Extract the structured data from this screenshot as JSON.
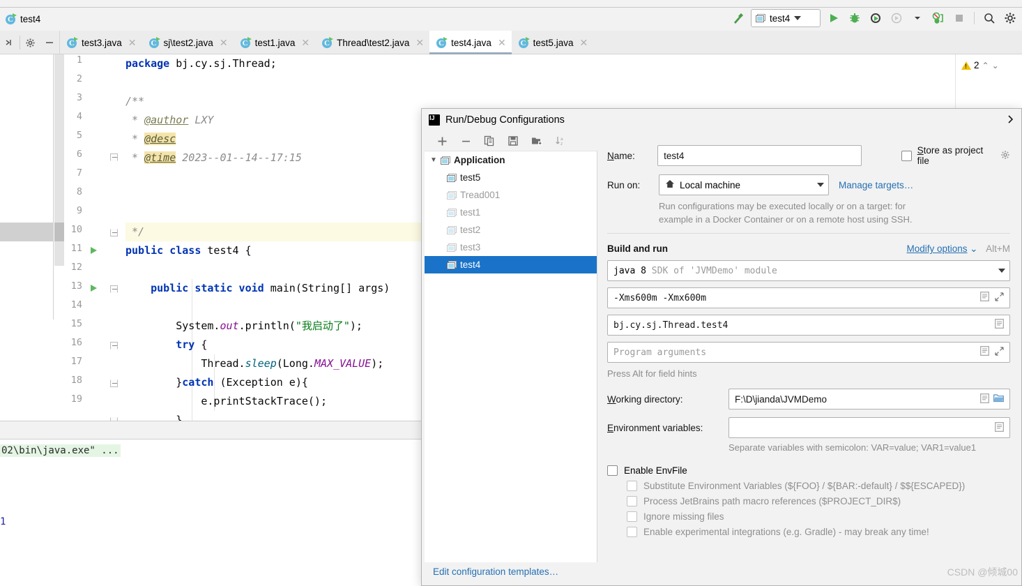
{
  "navbar": {
    "crumb": "test4",
    "icon": "java-class-icon"
  },
  "run_toolbar": {
    "build_icon": "hammer-icon",
    "config_name": "test4",
    "config_icon": "application-config-icon",
    "run_icon": "run-icon",
    "debug_icon": "debug-icon",
    "run_coverage_icon": "run-with-coverage-icon",
    "profiler_icon": "profiler-icon",
    "profiler_dropdown_icon": "chevron-down-icon",
    "attach_icon": "attach-debugger-icon",
    "stop_icon": "stop-icon",
    "search_icon": "search-icon",
    "settings_icon": "gear-icon"
  },
  "tab_toolbar": {
    "collapse_icon": "collapse-icon",
    "settings_icon": "gear-icon",
    "hide_icon": "minus-icon"
  },
  "editor_tabs": [
    {
      "label": "test3.java",
      "active": false
    },
    {
      "label": "sj\\test2.java",
      "active": false
    },
    {
      "label": "test1.java",
      "active": false
    },
    {
      "label": "Thread\\test2.java",
      "active": false
    },
    {
      "label": "test4.java",
      "active": true
    },
    {
      "label": "test5.java",
      "active": false
    }
  ],
  "editor": {
    "warning_count": "2",
    "warning_icon": "warning-triangle-icon",
    "up_icon": "chevron-up-icon",
    "down_icon": "chevron-down-icon",
    "line_numbers": [
      "1",
      "2",
      "3",
      "4",
      "5",
      "6",
      "7",
      "8",
      "9",
      "10",
      "11",
      "12",
      "13",
      "14",
      "15",
      "16",
      "17",
      "18",
      "19"
    ],
    "code": {
      "l1_package": "package",
      "l1_name": " bj.cy.sj.Thread;",
      "l3": "/**",
      "l4_star": " * ",
      "l4_tag": "@author",
      "l4_val": " LXY",
      "l5_star": " * ",
      "l5_tag": "@desc",
      "l6_star": " * ",
      "l6_tag": "@time",
      "l6_val": " 2023--01--14--17:15",
      "l7": " */",
      "l8_a": "public class",
      "l8_b": " test4 {",
      "l10_a": "    public static void",
      "l10_b": " main(String[] args)",
      "l12_a": "        System.",
      "l12_b": "out",
      "l12_c": ".println(",
      "l12_str": "\"我启动了\"",
      "l12_d": ");",
      "l13_a": "        ",
      "l13_kw": "try",
      "l13_b": " {",
      "l14_a": "            Thread.",
      "l14_b": "sleep",
      "l14_c": "(Long.",
      "l14_d": "MAX_VALUE",
      "l14_e": ");",
      "l15_a": "        }",
      "l15_kw": "catch",
      "l15_b": " (Exception e){",
      "l16": "            e.printStackTrace();",
      "l17": "        }",
      "l18": "    }",
      "l19": "}"
    }
  },
  "console": {
    "command_line": "02\\bin\\java.exe\" ...",
    "output_line": "1"
  },
  "dialog": {
    "title": "Run/Debug Configurations",
    "logo_icon": "intellij-logo-icon",
    "close_icon": "close-icon",
    "toolbar": [
      {
        "name": "add-configuration-button",
        "glyph": "+"
      },
      {
        "name": "remove-configuration-button",
        "glyph": "−"
      },
      {
        "name": "copy-configuration-button",
        "glyph": "copy-icon"
      },
      {
        "name": "save-configuration-button",
        "glyph": "save-icon"
      },
      {
        "name": "move-into-folder-button",
        "glyph": "folder-add-icon"
      },
      {
        "name": "sort-configurations-button",
        "glyph": "sort-alpha-icon"
      }
    ],
    "tree": {
      "root": "Application",
      "root_twisty": "chevron-down-icon",
      "items": [
        {
          "label": "test5",
          "dim": false,
          "selected": false
        },
        {
          "label": "Tread001",
          "dim": true,
          "selected": false
        },
        {
          "label": "test1",
          "dim": true,
          "selected": false
        },
        {
          "label": "test2",
          "dim": true,
          "selected": false
        },
        {
          "label": "test3",
          "dim": true,
          "selected": false
        },
        {
          "label": "test4",
          "dim": false,
          "selected": true
        }
      ]
    },
    "edit_templates_link": "Edit configuration templates…",
    "name_label": "Name:",
    "name_value": "test4",
    "store_as_project_file_label": "Store as project file",
    "store_as_project_file_gear_icon": "gear-icon",
    "run_on_label": "Run on:",
    "run_on_value": "Local machine",
    "run_on_icon": "home-icon",
    "manage_targets_link": "Manage targets…",
    "run_on_hint_1": "Run configurations may be executed locally or on a target: for",
    "run_on_hint_2": "example in a Docker Container or on a remote host using SSH.",
    "build_and_run_label": "Build and run",
    "modify_options_link": "Modify options",
    "modify_options_caret_icon": "chevron-down-icon",
    "modify_options_shortcut": "Alt+M",
    "jdk_value_a": "java 8",
    "jdk_value_b": " SDK of 'JVMDemo' module",
    "vm_options_value": "-Xms600m  -Xmx600m",
    "main_class_value": "bj.cy.sj.Thread.test4",
    "program_args_placeholder": "Program arguments",
    "field_hint": "Press Alt for field hints",
    "working_directory_label": "Working directory:",
    "working_directory_value": "F:\\D\\jianda\\JVMDemo",
    "environment_variables_label": "Environment variables:",
    "environment_variables_value": "",
    "env_hint": "Separate variables with semicolon: VAR=value; VAR1=value1",
    "enable_envfile_label": "Enable EnvFile",
    "envfile_options": [
      "Substitute Environment Variables (${FOO} / ${BAR:-default} / $${ESCAPED})",
      "Process JetBrains path macro references ($PROJECT_DIR$)",
      "Ignore missing files",
      "Enable experimental integrations (e.g. Gradle) - may break any time!"
    ],
    "macro_icon": "insert-macro-icon",
    "expand_icon": "expand-icon",
    "browse_icon": "folder-browse-icon"
  },
  "watermark": "CSDN @倾城00",
  "colors": {
    "accent_blue": "#1a73c8",
    "link_blue": "#2470b3",
    "keyword": "#0033b3",
    "string_green": "#067d17",
    "field_purple": "#871094",
    "comment_gray": "#8c8c8c",
    "warning_yellow": "#f0c000",
    "run_green": "#5fb85f"
  }
}
